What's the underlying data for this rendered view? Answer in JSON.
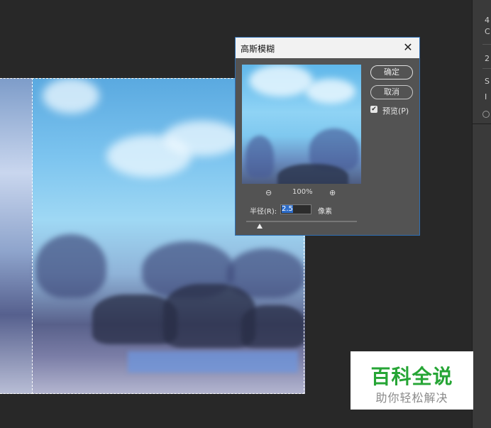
{
  "dialog": {
    "title": "高斯模糊",
    "close_label": "✕",
    "ok_label": "确定",
    "cancel_label": "取消",
    "preview_checkbox": {
      "label": "预览(P)",
      "checked": true
    },
    "zoom": {
      "zoom_out_icon": "zoom-out-icon",
      "zoom_in_icon": "zoom-in-icon",
      "value": "100%"
    },
    "radius": {
      "label": "半径(R):",
      "value": "2.5",
      "unit": "像素"
    },
    "slider": {
      "value": 2.5
    }
  },
  "right_panel": {
    "glyphs": [
      "4",
      "C",
      "2",
      "S",
      "I"
    ]
  },
  "watermark": {
    "title": "百科全说",
    "subtitle": "助你轻松解决",
    "color": "#26a535"
  },
  "colors": {
    "workspace": "#282828",
    "dialog_bg": "#535353",
    "dialog_border": "#2f6fb3"
  }
}
